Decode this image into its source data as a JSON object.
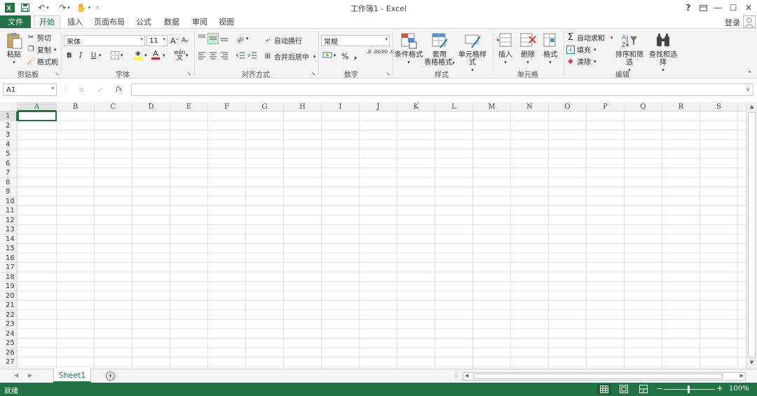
{
  "title": "工作簿1 - Excel",
  "quick_access": {
    "save": "save-icon",
    "undo": "undo-icon",
    "redo": "redo-icon",
    "touch": "touch-icon"
  },
  "window": {
    "help": "?",
    "minimize": "—",
    "restore": "☐",
    "close": "✕"
  },
  "tabs": {
    "file": "文件",
    "items": [
      "开始",
      "插入",
      "页面布局",
      "公式",
      "数据",
      "审阅",
      "视图"
    ],
    "active": "开始",
    "login": "登录"
  },
  "ribbon": {
    "clipboard": {
      "paste": "粘贴",
      "cut": "剪切",
      "copy": "复制",
      "format_painter": "格式刷",
      "label": "剪贴板"
    },
    "font": {
      "name": "宋体",
      "size": "11",
      "bold": "B",
      "italic": "I",
      "underline": "U",
      "label": "字体"
    },
    "alignment": {
      "wrap": "自动换行",
      "merge": "合并后居中",
      "label": "对齐方式"
    },
    "number": {
      "format": "常规",
      "percent": "%",
      "comma": ",",
      "inc_decimal": ".0 .00",
      "dec_decimal": ".00 .0",
      "label": "数字"
    },
    "styles": {
      "conditional": "条件格式",
      "table_l1": "套用",
      "table_l2": "表格格式",
      "cell_styles": "单元格样式",
      "label": "样式"
    },
    "cells": {
      "insert": "插入",
      "delete": "删除",
      "format": "格式",
      "label": "单元格"
    },
    "editing": {
      "autosum": "自动求和",
      "fill": "填充",
      "clear": "清除",
      "sort": "排序和筛选",
      "find": "查找和选择",
      "label": "编辑"
    }
  },
  "formula_bar": {
    "name_box": "A1",
    "fx": "fx",
    "value": ""
  },
  "columns": [
    "A",
    "B",
    "C",
    "D",
    "E",
    "F",
    "G",
    "H",
    "I",
    "J",
    "K",
    "L",
    "M",
    "N",
    "O",
    "P",
    "Q",
    "R",
    "S"
  ],
  "rows": [
    "1",
    "2",
    "3",
    "4",
    "5",
    "6",
    "7",
    "8",
    "9",
    "10",
    "11",
    "12",
    "13",
    "14",
    "15",
    "16",
    "17",
    "18",
    "19",
    "20",
    "21",
    "22",
    "23",
    "24",
    "25",
    "26",
    "27"
  ],
  "sheets": {
    "active": "Sheet1",
    "add": "+"
  },
  "status": {
    "ready": "就绪",
    "zoom": "100%"
  },
  "colors": {
    "accent": "#217346",
    "ribbon_bg": "#f5f5f5"
  }
}
